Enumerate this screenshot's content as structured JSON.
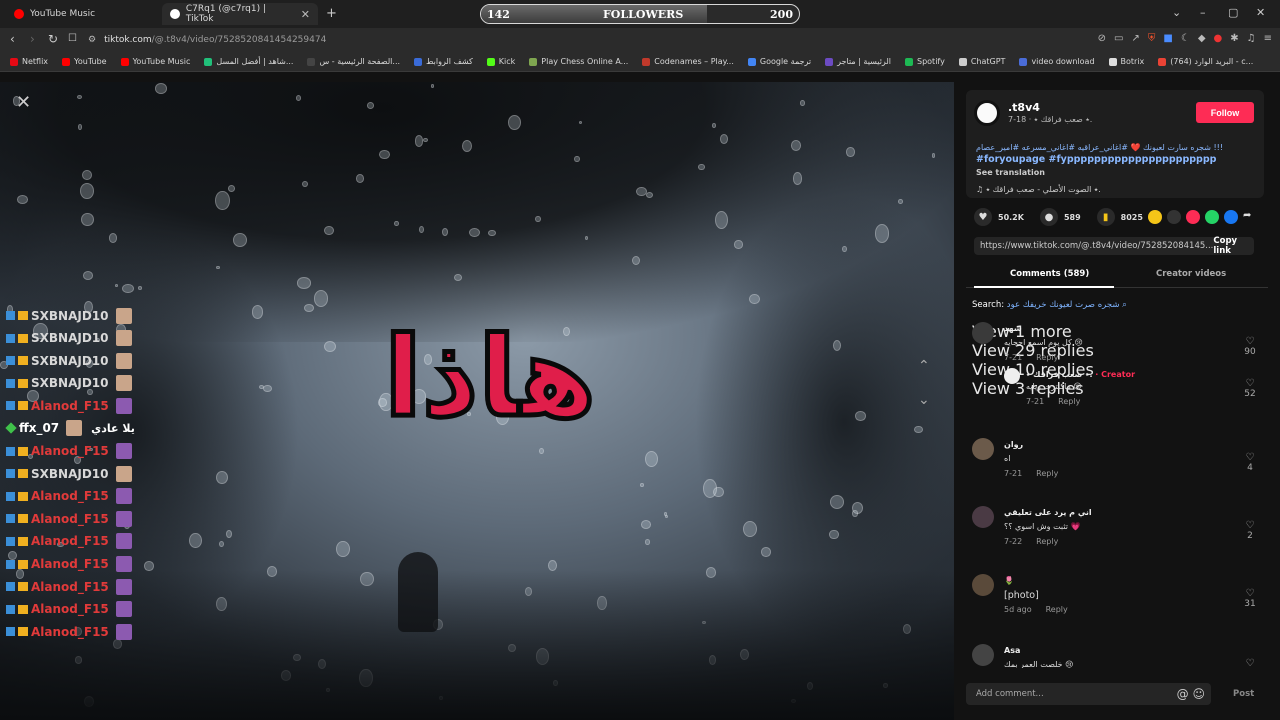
{
  "browser": {
    "tabs": [
      {
        "title": "YouTube Music",
        "active": false
      },
      {
        "title": "C7Rq1 (@c7rq1) | TikTok",
        "active": true
      }
    ],
    "new_tab": "+",
    "followers_widget": {
      "label": "FOLLOWERS",
      "current": "142",
      "goal": "200",
      "progress": 0.71
    },
    "window_controls": [
      "⌄",
      "–",
      "▢",
      "✕"
    ],
    "url_host": "tiktok.com",
    "url_path": "/@.t8v4/video/7528520841454259474",
    "bookmarks": [
      {
        "label": "Netflix",
        "color": "#e50914"
      },
      {
        "label": "YouTube",
        "color": "#ff0000"
      },
      {
        "label": "YouTube Music",
        "color": "#ff0000"
      },
      {
        "label": "شاهد | أفضل المسل...",
        "color": "#21c07a"
      },
      {
        "label": "الصفحة الرئيسية - س...",
        "color": "#444"
      },
      {
        "label": "كشف الروابط",
        "color": "#3a6bd8"
      },
      {
        "label": "Kick",
        "color": "#53fc18"
      },
      {
        "label": "Play Chess Online A...",
        "color": "#7fa650"
      },
      {
        "label": "Codenames – Play...",
        "color": "#c0392b"
      },
      {
        "label": "Google ترجمة",
        "color": "#4285f4"
      },
      {
        "label": "الرئيسية | متاجر",
        "color": "#6c4bc2"
      },
      {
        "label": "Spotify",
        "color": "#1db954"
      },
      {
        "label": "ChatGPT",
        "color": "#cccccc"
      },
      {
        "label": "video download",
        "color": "#4a6cd8"
      },
      {
        "label": "Botrix",
        "color": "#dddddd"
      },
      {
        "label": "(764) البريد الوارد - c...",
        "color": "#ea4335"
      }
    ]
  },
  "video": {
    "overlay_text": "هاذا",
    "chat": [
      {
        "name": "SXBNAJD10",
        "color": "#d8d8d8",
        "msg": "",
        "avatar": "tan"
      },
      {
        "name": "SXBNAJD10",
        "color": "#d8d8d8",
        "msg": "",
        "avatar": "tan"
      },
      {
        "name": "SXBNAJD10",
        "color": "#d8d8d8",
        "msg": "",
        "avatar": "tan"
      },
      {
        "name": "SXBNAJD10",
        "color": "#d8d8d8",
        "msg": "",
        "avatar": "tan"
      },
      {
        "name": "Alanod_F15",
        "color": "#e03a3a",
        "msg": "",
        "avatar": "purple"
      },
      {
        "name": "ffx_07",
        "color": "#ffffff",
        "msg": "يلا عادي",
        "avatar": "tan"
      },
      {
        "name": "Alanod_F15",
        "color": "#e03a3a",
        "msg": "",
        "avatar": "purple"
      },
      {
        "name": "SXBNAJD10",
        "color": "#d8d8d8",
        "msg": "",
        "avatar": "tan"
      },
      {
        "name": "Alanod_F15",
        "color": "#e03a3a",
        "msg": "",
        "avatar": "purple"
      },
      {
        "name": "Alanod_F15",
        "color": "#e03a3a",
        "msg": "",
        "avatar": "purple"
      },
      {
        "name": "Alanod_F15",
        "color": "#e03a3a",
        "msg": "",
        "avatar": "purple"
      },
      {
        "name": "Alanod_F15",
        "color": "#e03a3a",
        "msg": "",
        "avatar": "purple"
      },
      {
        "name": "Alanod_F15",
        "color": "#e03a3a",
        "msg": "",
        "avatar": "purple"
      },
      {
        "name": "Alanod_F15",
        "color": "#e03a3a",
        "msg": "",
        "avatar": "purple"
      },
      {
        "name": "Alanod_F15",
        "color": "#e03a3a",
        "msg": "",
        "avatar": "purple"
      }
    ]
  },
  "post": {
    "username": ".t8v4",
    "subline": "7-18 · ٭ صعب فراقك ٭.",
    "follow_label": "Follow",
    "description": "!!! شجره سارت لعيونك ❤️ #اغاني_عراقيه #اغاني_مسرعه #امير_عصام",
    "hashtags": "#foryoupage #fypppppppppppppppppppppp",
    "see_translation": "See translation",
    "sound": "♫ ٭ الصوت الأصلي - صعب فراقك ٭.",
    "likes": "50.2K",
    "comments_count": "589",
    "saves": "8025",
    "share_link": "https://www.tiktok.com/@.t8v4/video/752852084145...",
    "copy_link": "Copy link",
    "tab_comments": "Comments (589)",
    "tab_creator": "Creator videos",
    "search_label": "Search:",
    "search_query": "شجره صرت لعيونك خريفك عود"
  },
  "comments": [
    {
      "name": "شهد",
      "text": "كل يوم اسمع احجايه 😢",
      "date": "7-21",
      "reply": "Reply",
      "likes": "90"
    },
    {
      "name": "٭ صعب فراقك ٭.",
      "creator": "· Creator",
      "text": "ماكنترت ويايه 😢",
      "date": "7-21",
      "reply": "Reply",
      "likes": "52"
    },
    {
      "name": "روان",
      "text": "اه",
      "date": "7-21",
      "reply": "Reply",
      "likes": "4"
    },
    {
      "name": "اني م يرد على تعليقي",
      "text": "تثبت وش اسوي ؟؟ 💗",
      "date": "7-22",
      "reply": "Reply",
      "likes": "2"
    },
    {
      "name": "🌷",
      "text": "[photo]",
      "date": "5d ago",
      "reply": "Reply",
      "likes": "31"
    },
    {
      "name": "Asa",
      "text": "خلصت العمر بمك 😢",
      "date": "",
      "reply": "",
      "likes": ""
    }
  ],
  "more_replies": [
    "View 1 more",
    "View 29 replies",
    "View 10 replies",
    "View 3 replies"
  ],
  "add_comment": {
    "placeholder": "Add comment...",
    "post": "Post"
  }
}
